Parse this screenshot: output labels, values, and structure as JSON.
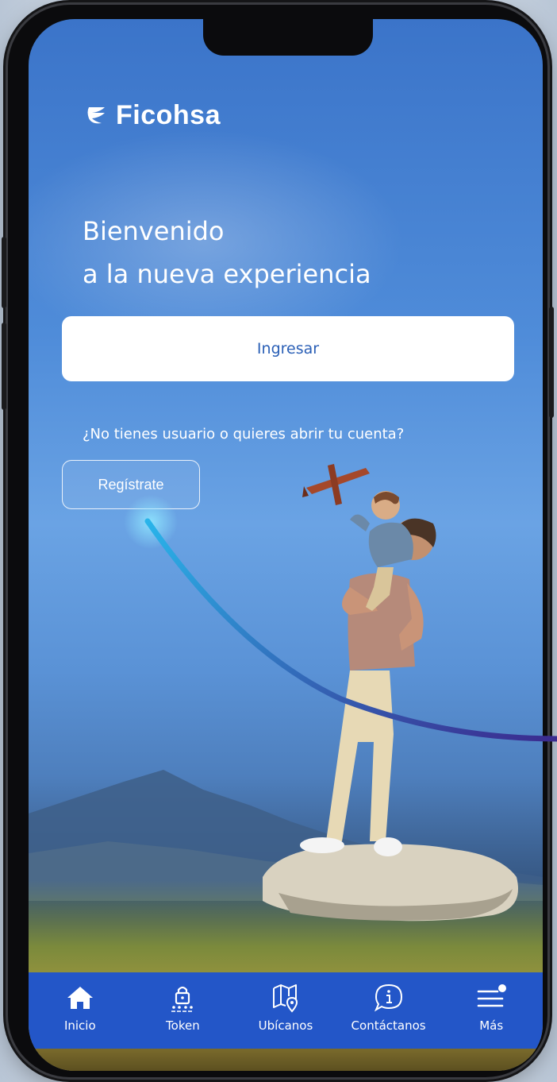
{
  "brand": {
    "name": "Ficohsa",
    "color_primary": "#2356c8",
    "color_text_on_primary": "#ffffff"
  },
  "welcome": {
    "line1": "Bienvenido",
    "line2": "a la nueva experiencia"
  },
  "login": {
    "label": "Ingresar"
  },
  "register": {
    "question": "¿No tienes usuario o quieres abrir tu cuenta?",
    "label": "Regístrate"
  },
  "tabbar": {
    "items": [
      {
        "label": "Inicio",
        "icon": "home-icon"
      },
      {
        "label": "Token",
        "icon": "lock-token-icon"
      },
      {
        "label": "Ubícanos",
        "icon": "map-pin-icon"
      },
      {
        "label": "Contáctanos",
        "icon": "info-chat-icon"
      },
      {
        "label": "Más",
        "icon": "menu-icon"
      }
    ]
  }
}
